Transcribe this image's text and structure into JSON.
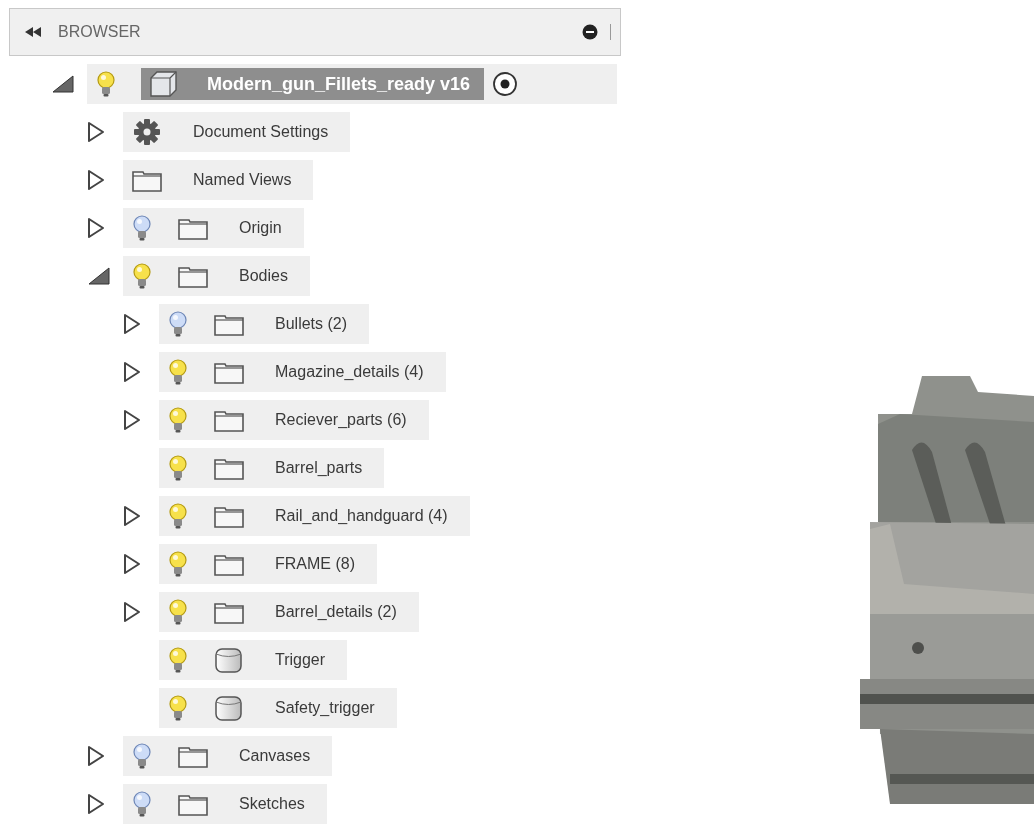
{
  "browser": {
    "title": "BROWSER"
  },
  "tree": [
    {
      "label": "Modern_gun_Fillets_ready v16",
      "kind": "component",
      "expandable": true,
      "expanded": true,
      "visible": true,
      "selected": true,
      "activated": true,
      "children": [
        {
          "label": "Document Settings",
          "kind": "settings",
          "expandable": true,
          "expanded": false,
          "selected": false
        },
        {
          "label": "Named Views",
          "kind": "folder",
          "expandable": true,
          "expanded": false,
          "selected": false
        },
        {
          "label": "Origin",
          "kind": "folder",
          "expandable": true,
          "expanded": false,
          "visible": false,
          "selected": false
        },
        {
          "label": "Bodies",
          "kind": "folder",
          "expandable": true,
          "expanded": true,
          "visible": true,
          "selected": false,
          "children": [
            {
              "label": "Bullets (2)",
              "kind": "folder",
              "expandable": true,
              "expanded": false,
              "visible": false,
              "selected": false
            },
            {
              "label": "Magazine_details (4)",
              "kind": "folder",
              "expandable": true,
              "expanded": false,
              "visible": true,
              "selected": false
            },
            {
              "label": "Reciever_parts (6)",
              "kind": "folder",
              "expandable": true,
              "expanded": false,
              "visible": true,
              "selected": false
            },
            {
              "label": "Barrel_parts",
              "kind": "folder",
              "expandable": false,
              "visible": true,
              "selected": false
            },
            {
              "label": "Rail_and_handguard (4)",
              "kind": "folder",
              "expandable": true,
              "expanded": false,
              "visible": true,
              "selected": false
            },
            {
              "label": "FRAME (8)",
              "kind": "folder",
              "expandable": true,
              "expanded": false,
              "visible": true,
              "selected": false
            },
            {
              "label": "Barrel_details (2)",
              "kind": "folder",
              "expandable": true,
              "expanded": false,
              "visible": true,
              "selected": false
            },
            {
              "label": "Trigger",
              "kind": "body",
              "expandable": false,
              "visible": true,
              "selected": false
            },
            {
              "label": "Safety_trigger",
              "kind": "body",
              "expandable": false,
              "visible": true,
              "selected": false
            }
          ]
        },
        {
          "label": "Canvases",
          "kind": "folder",
          "expandable": true,
          "expanded": false,
          "visible": false,
          "selected": false
        },
        {
          "label": "Sketches",
          "kind": "folder",
          "expandable": true,
          "expanded": false,
          "visible": false,
          "selected": false
        }
      ]
    }
  ]
}
